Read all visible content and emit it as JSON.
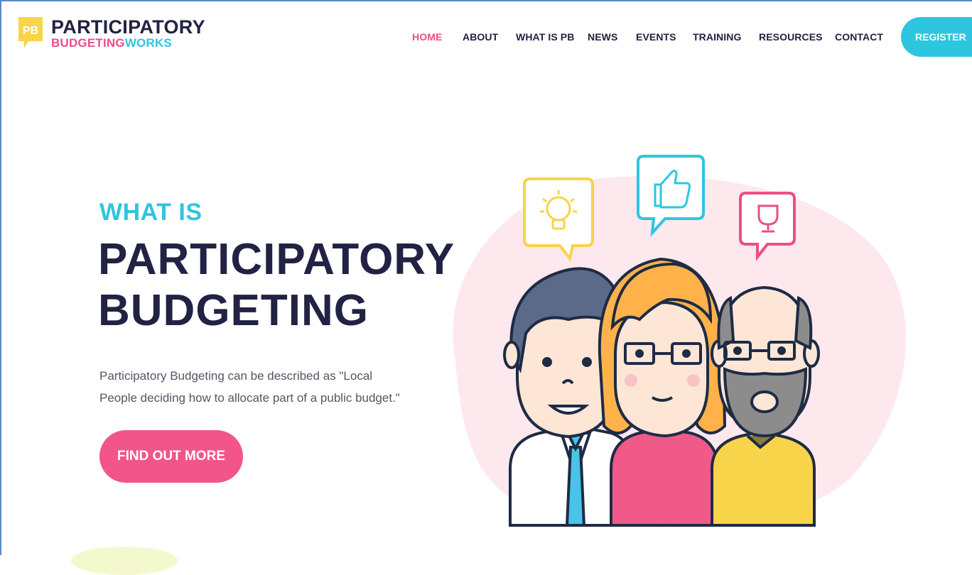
{
  "brand": {
    "badge": "PB",
    "title": "PARTICIPATORY",
    "sub_a": "BUDGETING",
    "sub_b": "WORKS"
  },
  "nav": {
    "items": [
      {
        "label": "HOME",
        "active": true
      },
      {
        "label": "ABOUT"
      },
      {
        "label": "WHAT IS PB"
      },
      {
        "label": "NEWS"
      },
      {
        "label": "EVENTS"
      },
      {
        "label": "TRAINING"
      },
      {
        "label": "RESOURCES"
      },
      {
        "label": "CONTACT"
      }
    ],
    "register": "REGISTER"
  },
  "hero": {
    "kicker": "WHAT IS",
    "title_line1": "PARTICIPATORY",
    "title_line2": "BUDGETING",
    "description": "Participatory Budgeting can be described as \"Local People deciding how to allocate part of a public budget.\"",
    "cta": "FIND OUT MORE"
  },
  "colors": {
    "navy": "#222244",
    "pink": "#ea4f86",
    "cyan": "#2ec6df",
    "yellow": "#f7d44a",
    "blob": "#fde8ee"
  },
  "icons": [
    "lightbulb-icon",
    "thumbs-up-icon",
    "trophy-icon"
  ]
}
